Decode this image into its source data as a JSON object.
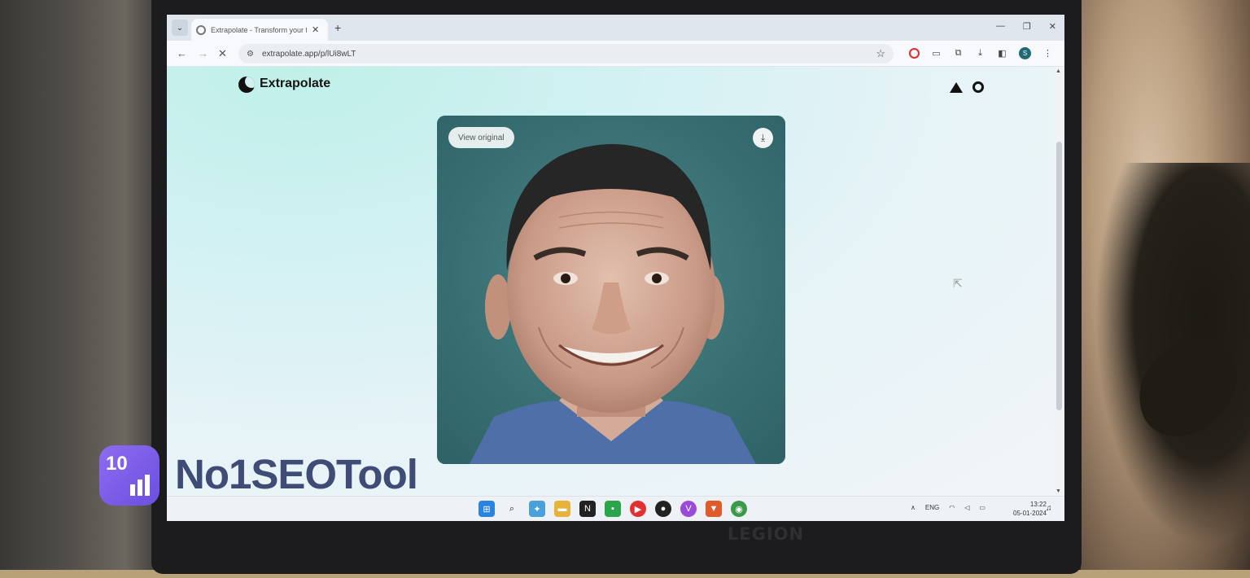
{
  "browser": {
    "tab_title": "Extrapolate - Transform your fa",
    "url": "extrapolate.app/p/lUi8wLT",
    "profile_initial": "S",
    "new_tab_label": "+"
  },
  "app": {
    "logo_text": "Extrapolate",
    "view_original_label": "View original",
    "download_icon_glyph": "⤓",
    "icons": [
      "vercel-icon",
      "github-icon"
    ]
  },
  "taskbar": {
    "language": "ENG",
    "time": "13:22",
    "date": "05-01-2024"
  },
  "watermark": {
    "text": "No1SEOTool",
    "logo_text": "10"
  },
  "laptop": {
    "brand": "LEGION"
  },
  "colors": {
    "photo_background": "#3d7478",
    "watermark_text": "#3e4c76",
    "watermark_logo": "#7a5cea"
  }
}
